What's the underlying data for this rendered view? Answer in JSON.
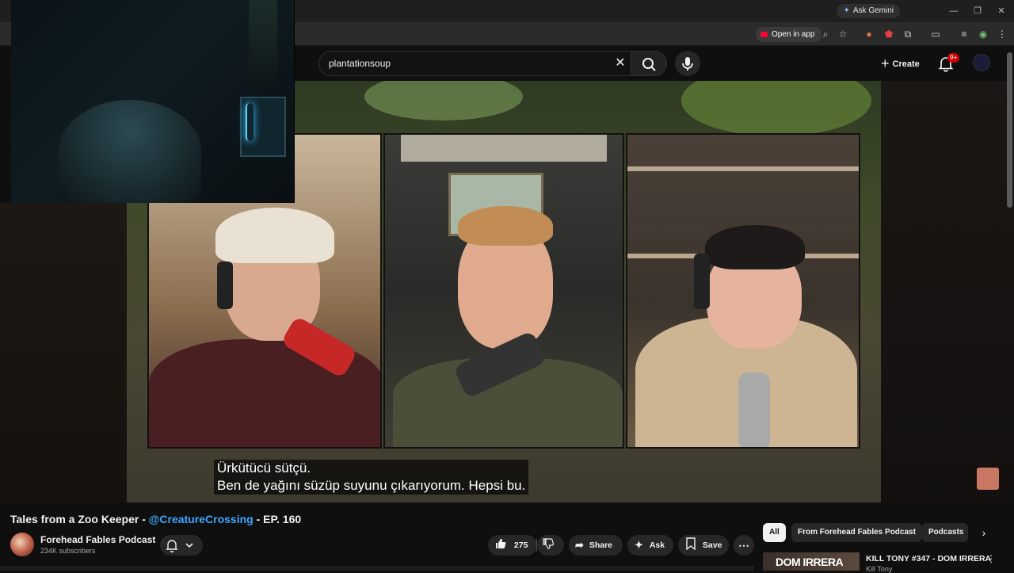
{
  "browser": {
    "gemini_label": "Ask Gemini",
    "open_in_app_label": "Open in app"
  },
  "header": {
    "search_value": "plantationsoup",
    "create_label": "Create",
    "notifications_badge": "9+"
  },
  "video": {
    "subtitles": [
      "Ürkütücü sütçü.",
      "Ben de yağını süzüp suyunu çıkarıyorum. Hepsi bu."
    ]
  },
  "title": {
    "part1": "Tales from a Zoo Keeper - ",
    "mention": "@CreatureCrossing",
    "part2": " - EP. 160"
  },
  "channel": {
    "name": "Forehead Fables Podcast",
    "subscribers": "234K subscribers"
  },
  "actions": {
    "likes": "275",
    "share_label": "Share",
    "ask_label": "Ask",
    "save_label": "Save"
  },
  "chips": [
    "All",
    "From Forehead Fables Podcast",
    "Podcasts"
  ],
  "recommended": {
    "thumb_text": "DOM IRRERA",
    "title": "KILL TONY #347 - DOM IRRERA",
    "channel": "Kill Tony"
  },
  "colors": {
    "background": "#0f0f0f",
    "accent_red": "#ff0033",
    "mention_blue": "#3ea6ff"
  }
}
